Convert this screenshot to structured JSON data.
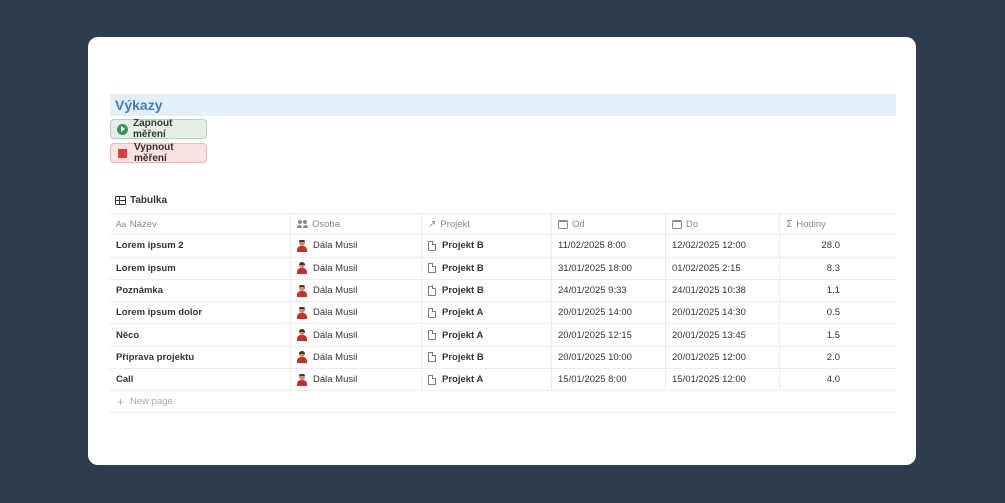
{
  "page": {
    "title": "Výkazy",
    "buttons": {
      "start": "Zapnout měření",
      "stop": "Vypnout měření"
    },
    "view_tab": "Tabulka"
  },
  "table": {
    "columns": {
      "name": "Název",
      "person": "Osoba",
      "project": "Projekt",
      "from": "Od",
      "to": "Do",
      "hours": "Hodiny"
    },
    "rows": [
      {
        "name": "Lorem ipsum 2",
        "person": "Dála Musil",
        "project": "Projekt B",
        "from": "11/02/2025 8:00",
        "to": "12/02/2025 12:00",
        "hours": "28.0"
      },
      {
        "name": "Lorem ipsum",
        "person": "Dála Musil",
        "project": "Projekt B",
        "from": "31/01/2025 18:00",
        "to": "01/02/2025 2:15",
        "hours": "8.3"
      },
      {
        "name": "Poznámka",
        "person": "Dála Musil",
        "project": "Projekt B",
        "from": "24/01/2025 9:33",
        "to": "24/01/2025 10:38",
        "hours": "1.1"
      },
      {
        "name": "Lorem ipsum dolor",
        "person": "Dála Musil",
        "project": "Projekt A",
        "from": "20/01/2025 14:00",
        "to": "20/01/2025 14:30",
        "hours": "0.5"
      },
      {
        "name": "Něco",
        "person": "Dála Musil",
        "project": "Projekt A",
        "from": "20/01/2025 12:15",
        "to": "20/01/2025 13:45",
        "hours": "1.5"
      },
      {
        "name": "Příprava projektu",
        "person": "Dála Musil",
        "project": "Projekt B",
        "from": "20/01/2025 10:00",
        "to": "20/01/2025 12:00",
        "hours": "2.0"
      },
      {
        "name": "Call",
        "person": "Dála Musil",
        "project": "Projekt A",
        "from": "15/01/2025 8:00",
        "to": "15/01/2025 12:00",
        "hours": "4.0"
      }
    ],
    "new_page_label": "New page"
  },
  "icons": {
    "title_prefix": "Aa",
    "people": "people-icon",
    "relation": "arrow-up-right-icon",
    "calendar": "calendar-icon",
    "sum": "sigma-icon",
    "document": "document-icon",
    "avatar": "user-avatar"
  },
  "colors": {
    "background": "#2e3c50",
    "heading_bg": "#e4eff8",
    "heading_text": "#3f7fc2",
    "start_button_bg": "#e5efe8",
    "start_icon": "#3f8f5a",
    "stop_button_bg": "#f9e3e2",
    "stop_icon": "#d9413a"
  }
}
